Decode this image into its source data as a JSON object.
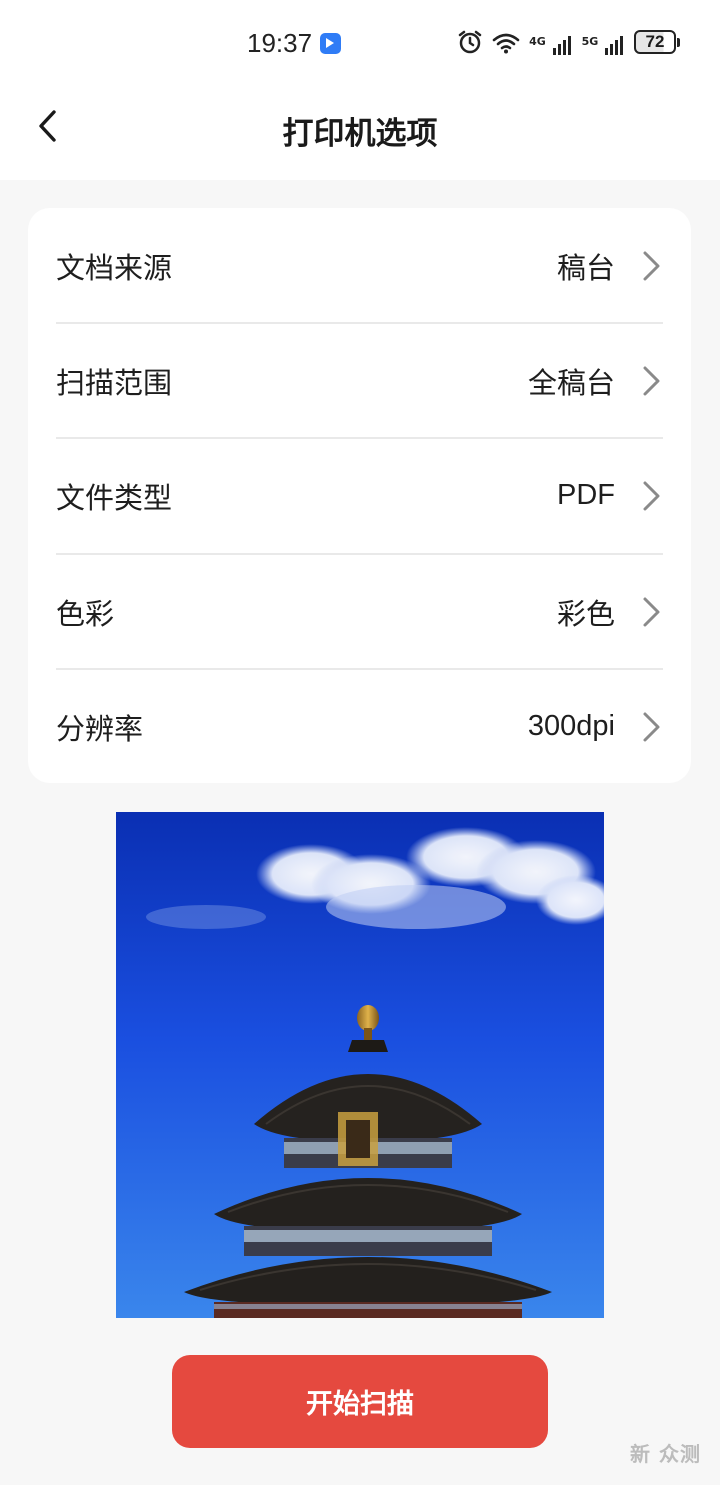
{
  "status_bar": {
    "time": "19:37",
    "battery": "72",
    "net_label_1": "4G",
    "net_label_2": "5G"
  },
  "header": {
    "title": "打印机选项"
  },
  "options": [
    {
      "label": "文档来源",
      "value": "稿台"
    },
    {
      "label": "扫描范围",
      "value": "全稿台"
    },
    {
      "label": "文件类型",
      "value": "PDF"
    },
    {
      "label": "色彩",
      "value": "彩色"
    },
    {
      "label": "分辨率",
      "value": "300dpi"
    }
  ],
  "preview": {
    "description_icon": "scan-preview-image"
  },
  "actions": {
    "start_scan": "开始扫描"
  },
  "watermark": "新 众测",
  "colors": {
    "accent": "#e5493f",
    "background": "#f7f7f7",
    "card": "#ffffff",
    "sky": "#1d4fd8"
  }
}
